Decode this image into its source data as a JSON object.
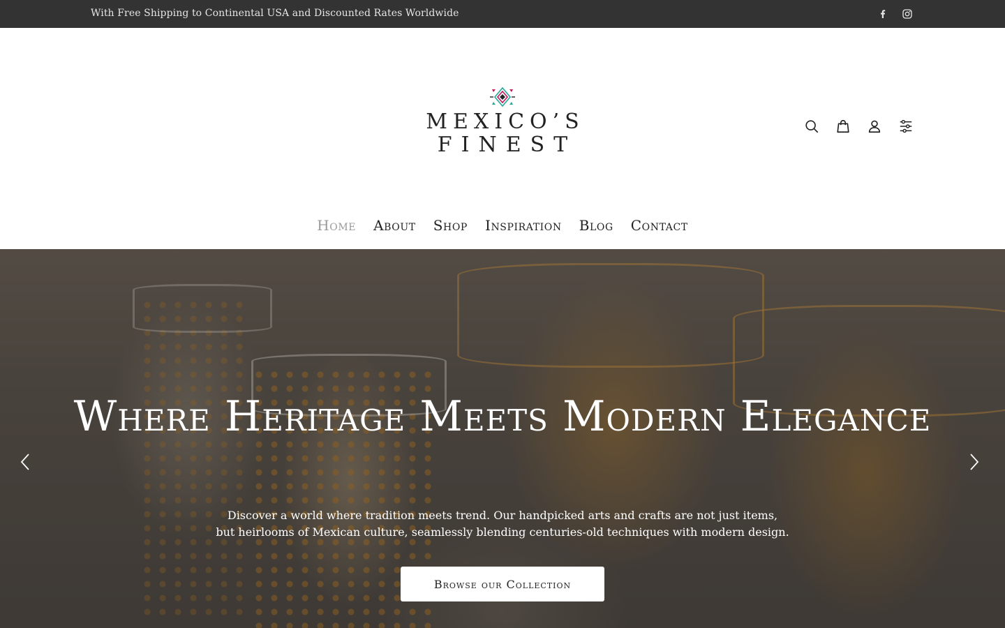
{
  "announcement": {
    "text": "With Free Shipping to Continental USA and Discounted Rates Worldwide",
    "social": [
      "facebook-icon",
      "instagram-icon"
    ]
  },
  "brand": {
    "line1": "MEXICO’S",
    "line2": "FINEST",
    "colors": {
      "magenta": "#c2185b",
      "teal": "#26a69a",
      "dark": "#222222"
    }
  },
  "header_icons": [
    "search-icon",
    "cart-icon",
    "user-icon",
    "filter-icon"
  ],
  "nav": {
    "items": [
      {
        "label": "Home",
        "active": true
      },
      {
        "label": "About",
        "active": false
      },
      {
        "label": "Shop",
        "active": false
      },
      {
        "label": "Inspiration",
        "active": false
      },
      {
        "label": "Blog",
        "active": false
      },
      {
        "label": "Contact",
        "active": false
      }
    ]
  },
  "hero": {
    "title": "Where Heritage Meets Modern Elegance",
    "subtitle_line1": "Discover a world where tradition meets trend. Our handpicked arts and crafts are not just items,",
    "subtitle_line2": "but heirlooms of Mexican culture, seamlessly blending centuries-old techniques with modern design.",
    "cta_label": "Browse our Collection",
    "prev_icon": "chevron-left-icon",
    "next_icon": "chevron-right-icon"
  },
  "colors": {
    "topbar_bg": "#333333",
    "nav_active": "#9a9a9a",
    "text": "#222222"
  }
}
